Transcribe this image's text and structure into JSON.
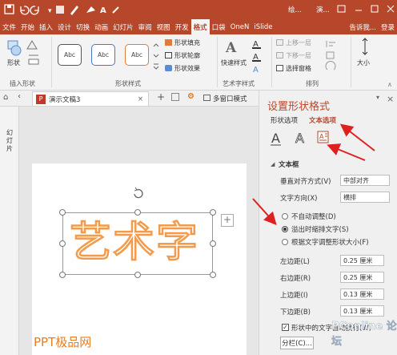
{
  "titlebar": {
    "icons": [
      "save-icon",
      "undo-icon",
      "redo-icon",
      "paint-icon",
      "pen-icon",
      "fill-icon",
      "font-color-icon",
      "brush-icon"
    ],
    "tab_hint_1": "绘...",
    "tab_hint_2": "演...",
    "window_controls": [
      "restore-icon",
      "minimize-icon",
      "maximize-icon",
      "close-icon"
    ]
  },
  "tabs": [
    "文件",
    "开始",
    "插入",
    "设计",
    "切换",
    "动画",
    "幻灯片",
    "审阅",
    "视图",
    "开发",
    "格式",
    "口袋",
    "OneN",
    "iSlide",
    "告诉我...",
    "登录"
  ],
  "active_tab": "格式",
  "ribbon": {
    "insert_shape_group": "插入形状",
    "shape_label": "形状",
    "shape_styles_group": "形状样式",
    "style_sample": "Abc",
    "shape_fill": "形状填充",
    "shape_outline": "形状轮廓",
    "shape_effect": "形状效果",
    "quick_styles": "快速样式",
    "art_styles_group": "艺术字样式",
    "bring_forward": "上移一层",
    "send_backward": "下移一层",
    "selection_pane": "选择窗格",
    "arrange_group": "排列",
    "size": "大小"
  },
  "doc_tabs": {
    "doc_name": "演示文稿3",
    "close": "×",
    "add": "+",
    "multi_window": "多窗口模式"
  },
  "left_panel": {
    "label": "幻灯片"
  },
  "slide": {
    "art_text": "艺术字",
    "watermark": "PPT极品网"
  },
  "format_pane": {
    "title": "设置形状格式",
    "tab_shape_options": "形状选项",
    "tab_text_options": "文本选项",
    "section": "文本框",
    "vertical_align_label": "垂直对齐方式(V)",
    "vertical_align_value": "中部对齐",
    "text_direction_label": "文字方向(X)",
    "text_direction_value": "横排",
    "radio_no_autofit": "不自动调整(D)",
    "radio_overflow": "溢出时缩排文字(S)",
    "radio_resize": "根据文字调整形状大小(F)",
    "left_margin_label": "左边距(L)",
    "left_margin_value": "0.25 厘米",
    "right_margin_label": "右边距(R)",
    "right_margin_value": "0.25 厘米",
    "top_margin_label": "上边距(I)",
    "top_margin_value": "0.13 厘米",
    "bottom_margin_label": "下边距(B)",
    "bottom_margin_value": "0.13 厘米",
    "wrap_label": "形状中的文字自动换行(W)",
    "columns_button": "分栏(C)...",
    "close": "×"
  },
  "watermark_site": "PConline 论坛",
  "colors": {
    "brand": "#b7472a",
    "accent_text": "#c0392b",
    "art_orange": "#f29b4c",
    "arrow": "#e02020"
  }
}
